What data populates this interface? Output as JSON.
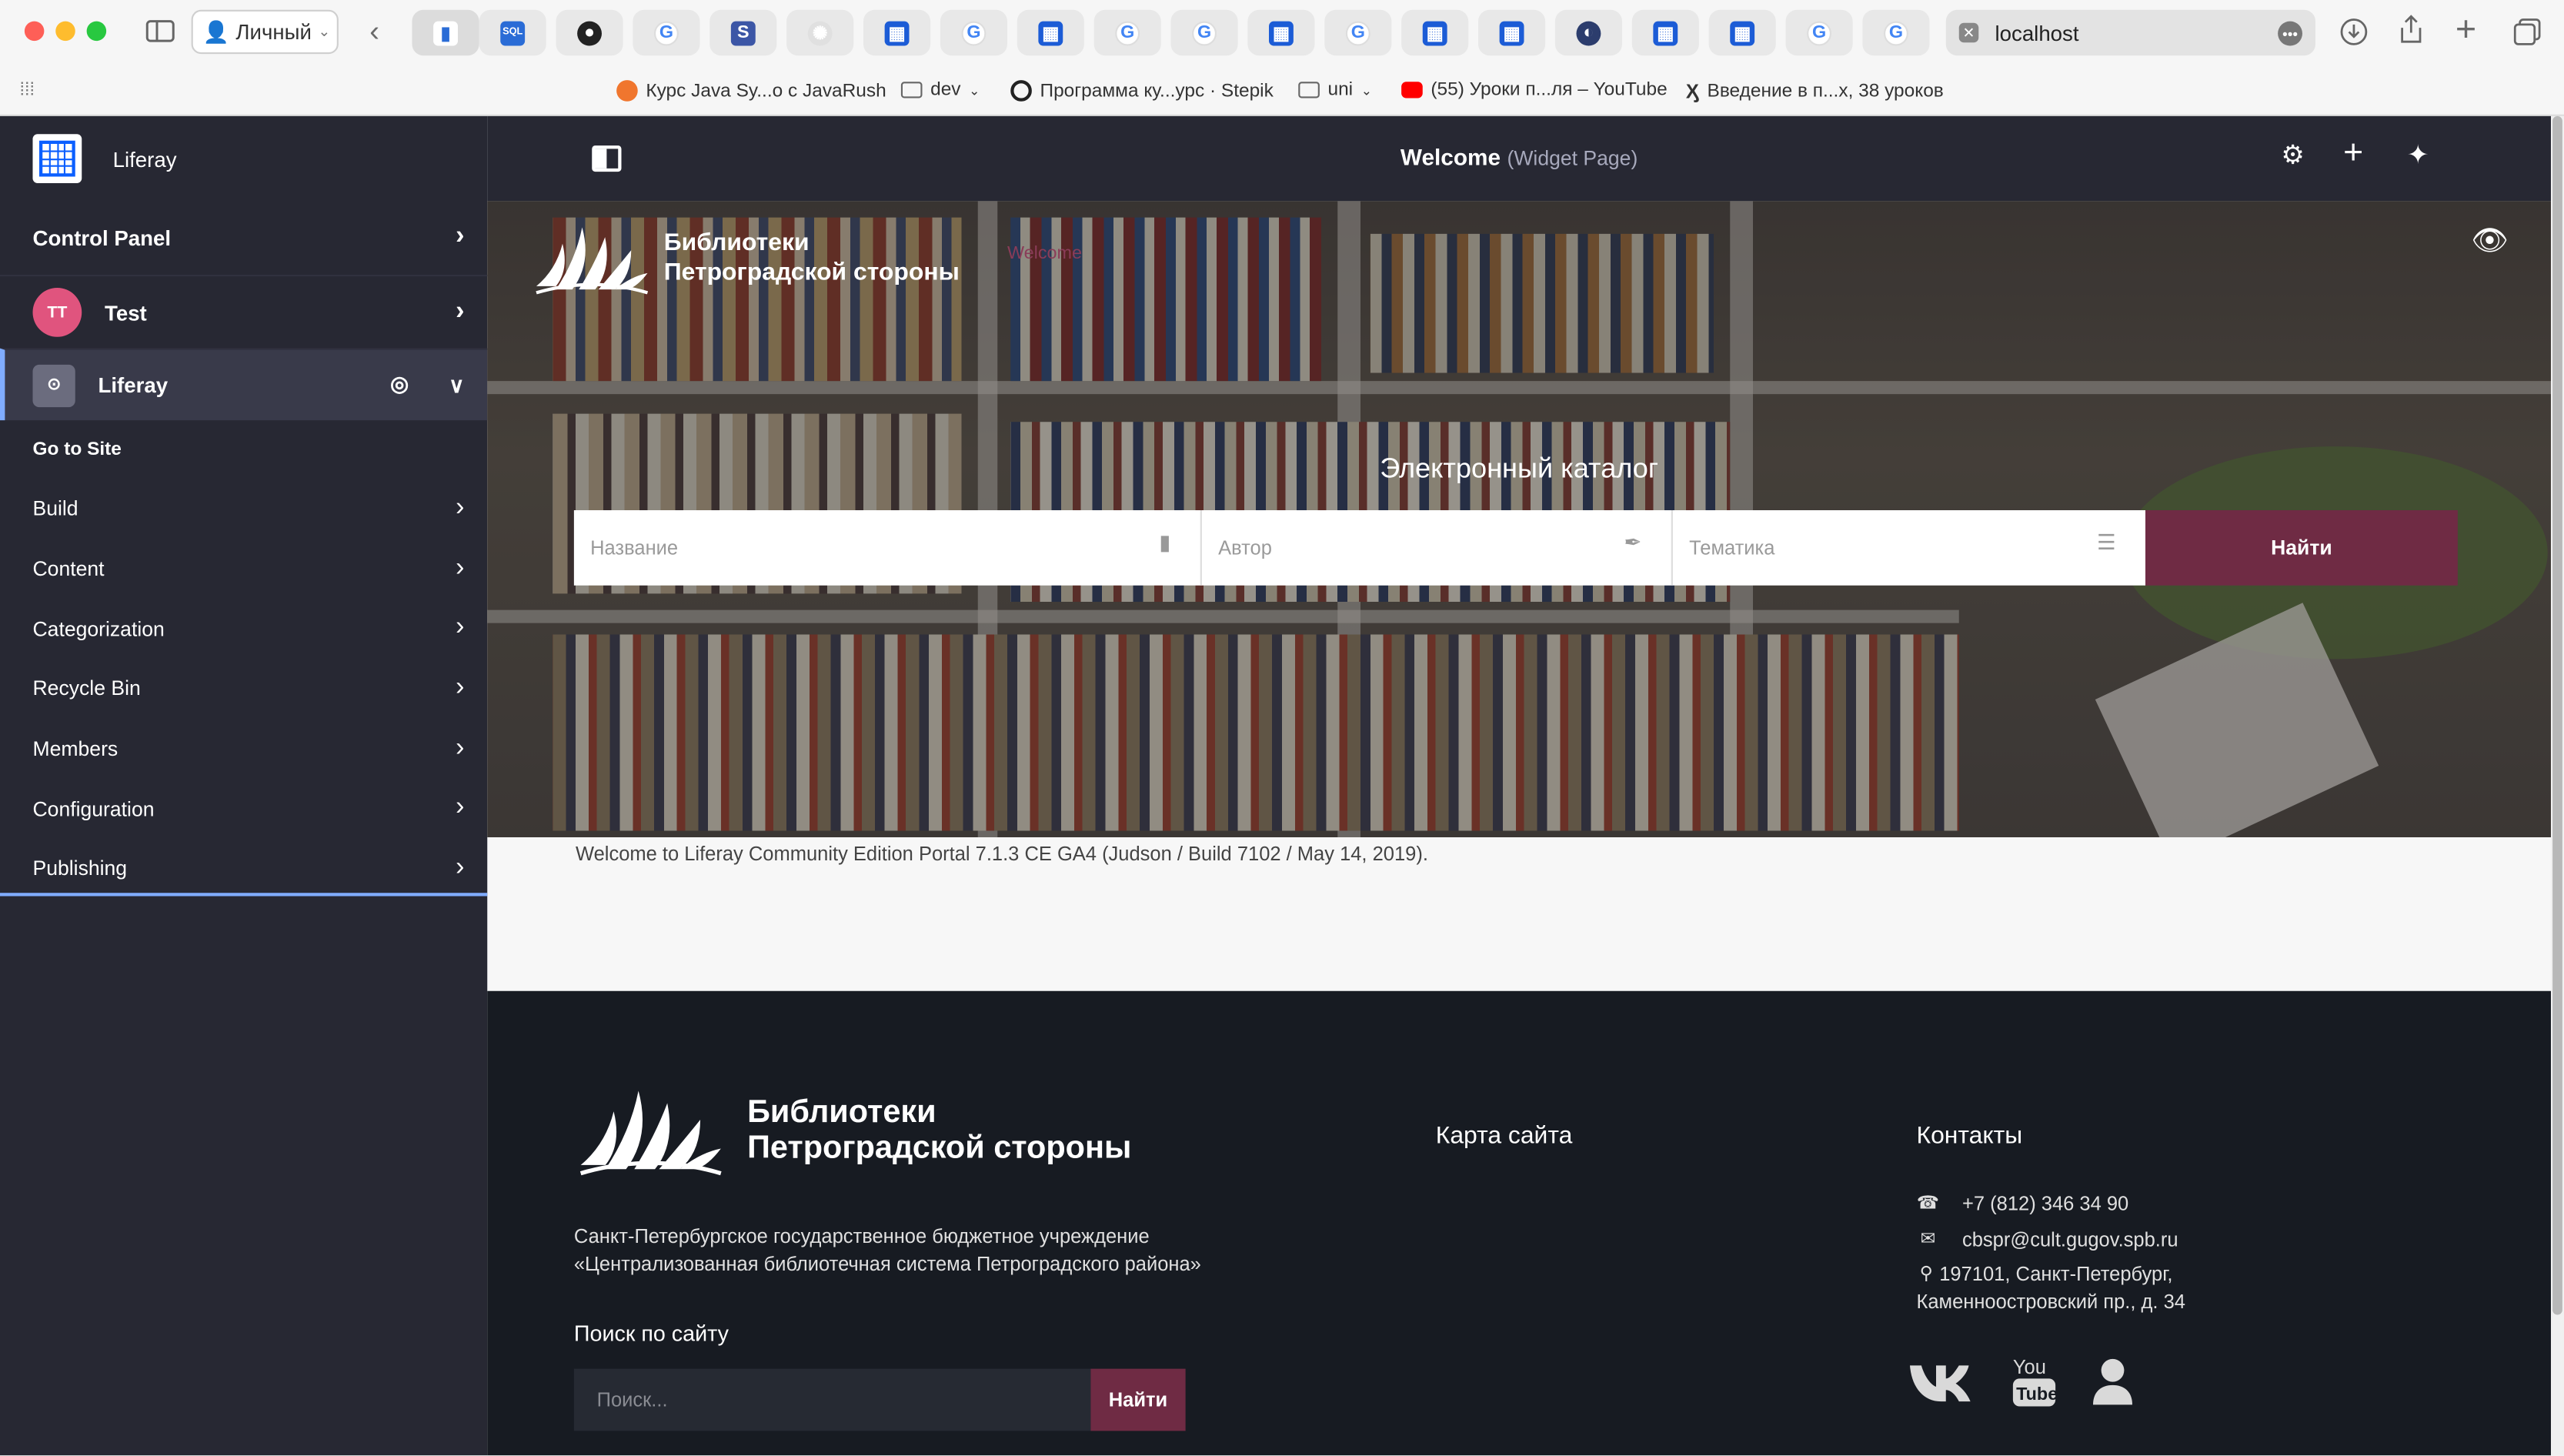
{
  "browser": {
    "profile_label": "Личный",
    "address": "localhost",
    "bookmarks": [
      {
        "label": "Курс Java Sy...о с JavaRush"
      },
      {
        "label": "dev"
      },
      {
        "label": "Программа ку...урс · Stepik"
      },
      {
        "label": "uni"
      },
      {
        "label": "(55) Уроки п...ля – YouTube"
      },
      {
        "label": "Введение в п...х, 38 уроков"
      }
    ]
  },
  "sidebar": {
    "site_name": "Liferay",
    "control_panel": "Control Panel",
    "user": {
      "initials": "TT",
      "name": "Test"
    },
    "current_site": "Liferay",
    "go_to_site": "Go to Site",
    "items": [
      {
        "label": "Build"
      },
      {
        "label": "Content"
      },
      {
        "label": "Categorization"
      },
      {
        "label": "Recycle Bin"
      },
      {
        "label": "Members"
      },
      {
        "label": "Configuration"
      },
      {
        "label": "Publishing"
      }
    ]
  },
  "control_bar": {
    "page_title": "Welcome",
    "page_type": "(Widget Page)"
  },
  "hero": {
    "brand_line1": "Библиотеки",
    "brand_line2": "Петроградской стороны",
    "faint_label": "Welcome",
    "catalog_title": "Электронный каталог",
    "search": {
      "title_placeholder": "Название",
      "author_placeholder": "Автор",
      "topic_placeholder": "Тематика",
      "button": "Найти"
    }
  },
  "welcome_text": "Welcome to Liferay Community Edition Portal 7.1.3 CE GA4 (Judson / Build 7102 / May 14, 2019).",
  "footer": {
    "brand_line1": "Библиотеки",
    "brand_line2": "Петроградской стороны",
    "org_line1": "Санкт-Петербургское государственное бюджетное учреждение",
    "org_line2": "«Централизованная библиотечная система Петроградского района»",
    "site_search_title": "Поиск по сайту",
    "site_search_placeholder": "Поиск...",
    "site_search_button": "Найти",
    "sitemap_title": "Карта сайта",
    "contacts_title": "Контакты",
    "phone": "+7 (812) 346 34 90",
    "email": "cbspr@cult.gugov.spb.ru",
    "address_line1": "197101, Санкт-Петербург,",
    "address_line2": "Каменноостровский пр., д. 34"
  },
  "colors": {
    "sidebar_bg": "#272833",
    "accent_burgundy": "#6f2b44",
    "footer_bg": "#171b22",
    "active_blue": "#80acff"
  },
  "icons": {
    "social": [
      "vk-icon",
      "youtube-icon",
      "user-icon"
    ],
    "control_bar": [
      "gear-icon",
      "plus-icon",
      "simulation-icon"
    ]
  }
}
